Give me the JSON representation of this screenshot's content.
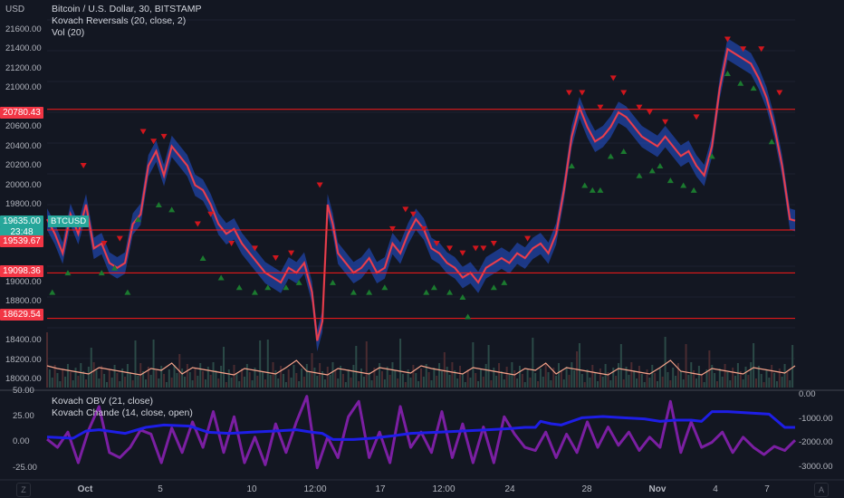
{
  "currency_label": "USD",
  "legend": {
    "title": "Bitcoin / U.S. Dollar, 30, BITSTAMP",
    "indicator1": "Kovach Reversals (20, close, 2)",
    "indicator2": "Vol (20)"
  },
  "price_axis": [
    "21600.00",
    "21400.00",
    "21200.00",
    "21000.00",
    "20600.00",
    "20400.00",
    "20200.00",
    "20000.00",
    "19800.00",
    "19000.00",
    "18800.00",
    "18400.00",
    "18200.00",
    "18000.00"
  ],
  "tags": {
    "h1": "20780.43",
    "price": "19635.00",
    "symbol": "BTCUSD",
    "countdown": "23:48",
    "h2": "19539.67",
    "h3": "19098.36",
    "h4": "18629.54"
  },
  "lower_legend": {
    "indicator1": "Kovach OBV (21, close)",
    "indicator2": "Kovach Chande (14, close, open)"
  },
  "lower_left_axis": [
    "50.00",
    "25.00",
    "0.00",
    "-25.00"
  ],
  "lower_right_axis": [
    "0.00",
    "-1000.00",
    "-2000.00",
    "-3000.00"
  ],
  "time_axis": [
    "Oct",
    "5",
    "10",
    "12:00",
    "17",
    "12:00",
    "24",
    "28",
    "Nov",
    "4",
    "7"
  ],
  "corner_left": "Z",
  "corner_right": "A",
  "colors": {
    "background": "#131722",
    "hline": "#ff1a1a",
    "price_tag": "#26a69a",
    "band": "#2962ff",
    "ma": "#f23645",
    "obv": "#1e1ee6",
    "chande": "#7b1fa2",
    "up_marker": "#1b7a2f",
    "down_marker": "#d0161d"
  },
  "chart_data": {
    "type": "line",
    "symbol": "Bitcoin / U.S. Dollar, 30, BITSTAMP",
    "price_path": [
      [
        0,
        19650
      ],
      [
        3,
        19500
      ],
      [
        6,
        19300
      ],
      [
        9,
        19700
      ],
      [
        12,
        19500
      ],
      [
        15,
        19800
      ],
      [
        18,
        19350
      ],
      [
        21,
        19400
      ],
      [
        24,
        19200
      ],
      [
        27,
        19150
      ],
      [
        30,
        19200
      ],
      [
        33,
        19600
      ],
      [
        36,
        19700
      ],
      [
        39,
        20200
      ],
      [
        42,
        20350
      ],
      [
        45,
        20100
      ],
      [
        48,
        20400
      ],
      [
        51,
        20300
      ],
      [
        54,
        20200
      ],
      [
        57,
        20000
      ],
      [
        60,
        19950
      ],
      [
        63,
        19800
      ],
      [
        66,
        19600
      ],
      [
        69,
        19500
      ],
      [
        72,
        19550
      ],
      [
        75,
        19400
      ],
      [
        78,
        19300
      ],
      [
        81,
        19200
      ],
      [
        84,
        19100
      ],
      [
        87,
        19050
      ],
      [
        90,
        19000
      ],
      [
        93,
        19150
      ],
      [
        96,
        19100
      ],
      [
        99,
        19200
      ],
      [
        102,
        18900
      ],
      [
        104,
        18400
      ],
      [
        106,
        18600
      ],
      [
        108,
        19800
      ],
      [
        110,
        19600
      ],
      [
        112,
        19300
      ],
      [
        115,
        19200
      ],
      [
        118,
        19100
      ],
      [
        121,
        19150
      ],
      [
        124,
        19250
      ],
      [
        127,
        19100
      ],
      [
        130,
        19150
      ],
      [
        133,
        19400
      ],
      [
        136,
        19300
      ],
      [
        139,
        19500
      ],
      [
        142,
        19650
      ],
      [
        145,
        19550
      ],
      [
        148,
        19350
      ],
      [
        151,
        19300
      ],
      [
        154,
        19200
      ],
      [
        157,
        19150
      ],
      [
        160,
        19050
      ],
      [
        163,
        19100
      ],
      [
        166,
        19000
      ],
      [
        169,
        19150
      ],
      [
        172,
        19200
      ],
      [
        175,
        19250
      ],
      [
        178,
        19200
      ],
      [
        181,
        19300
      ],
      [
        184,
        19250
      ],
      [
        187,
        19350
      ],
      [
        190,
        19400
      ],
      [
        193,
        19300
      ],
      [
        196,
        19500
      ],
      [
        199,
        19950
      ],
      [
        202,
        20500
      ],
      [
        205,
        20800
      ],
      [
        208,
        20600
      ],
      [
        211,
        20450
      ],
      [
        214,
        20500
      ],
      [
        217,
        20600
      ],
      [
        220,
        20750
      ],
      [
        223,
        20700
      ],
      [
        226,
        20600
      ],
      [
        229,
        20500
      ],
      [
        232,
        20450
      ],
      [
        235,
        20400
      ],
      [
        238,
        20500
      ],
      [
        241,
        20400
      ],
      [
        244,
        20300
      ],
      [
        247,
        20350
      ],
      [
        250,
        20200
      ],
      [
        253,
        20100
      ],
      [
        256,
        20400
      ],
      [
        259,
        21000
      ],
      [
        262,
        21400
      ],
      [
        265,
        21350
      ],
      [
        268,
        21300
      ],
      [
        271,
        21250
      ],
      [
        274,
        21100
      ],
      [
        277,
        20900
      ],
      [
        280,
        20600
      ],
      [
        283,
        20200
      ],
      [
        286,
        19650
      ],
      [
        288,
        19635
      ]
    ],
    "horizontal_levels": [
      20780.43,
      19539.67,
      19098.36,
      18629.54
    ],
    "last_price": 19635.0,
    "down_markers": [
      [
        14,
        20200
      ],
      [
        22,
        19400
      ],
      [
        28,
        19450
      ],
      [
        37,
        20550
      ],
      [
        41,
        20450
      ],
      [
        45,
        20500
      ],
      [
        58,
        19600
      ],
      [
        63,
        19700
      ],
      [
        71,
        19400
      ],
      [
        80,
        19350
      ],
      [
        88,
        19250
      ],
      [
        94,
        19300
      ],
      [
        105,
        20000
      ],
      [
        133,
        19550
      ],
      [
        138,
        19750
      ],
      [
        141,
        19700
      ],
      [
        145,
        19550
      ],
      [
        150,
        19400
      ],
      [
        155,
        19350
      ],
      [
        160,
        19300
      ],
      [
        165,
        19350
      ],
      [
        168,
        19350
      ],
      [
        172,
        19400
      ],
      [
        185,
        19450
      ],
      [
        201,
        20950
      ],
      [
        206,
        20950
      ],
      [
        213,
        20800
      ],
      [
        218,
        21100
      ],
      [
        222,
        20950
      ],
      [
        228,
        20800
      ],
      [
        232,
        20750
      ],
      [
        238,
        20650
      ],
      [
        250,
        20700
      ],
      [
        262,
        21500
      ],
      [
        268,
        21400
      ],
      [
        275,
        21400
      ],
      [
        282,
        20950
      ]
    ],
    "up_markers": [
      [
        2,
        18900
      ],
      [
        8,
        19100
      ],
      [
        21,
        19100
      ],
      [
        26,
        19150
      ],
      [
        31,
        18900
      ],
      [
        35,
        19650
      ],
      [
        43,
        19800
      ],
      [
        48,
        19750
      ],
      [
        60,
        19250
      ],
      [
        67,
        19050
      ],
      [
        74,
        18950
      ],
      [
        80,
        18900
      ],
      [
        85,
        18950
      ],
      [
        92,
        18950
      ],
      [
        97,
        19000
      ],
      [
        110,
        19000
      ],
      [
        118,
        18900
      ],
      [
        124,
        18900
      ],
      [
        130,
        18950
      ],
      [
        146,
        18900
      ],
      [
        149,
        18950
      ],
      [
        155,
        18900
      ],
      [
        160,
        18850
      ],
      [
        162,
        18650
      ],
      [
        172,
        18950
      ],
      [
        176,
        19000
      ],
      [
        202,
        20200
      ],
      [
        207,
        20000
      ],
      [
        210,
        19950
      ],
      [
        213,
        19950
      ],
      [
        217,
        20300
      ],
      [
        222,
        20350
      ],
      [
        228,
        20100
      ],
      [
        233,
        20150
      ],
      [
        236,
        20200
      ],
      [
        240,
        20050
      ],
      [
        245,
        20000
      ],
      [
        249,
        19950
      ],
      [
        256,
        20300
      ],
      [
        262,
        21150
      ],
      [
        267,
        21050
      ],
      [
        272,
        21000
      ],
      [
        279,
        20450
      ]
    ],
    "obv_path": [
      [
        0,
        -1750
      ],
      [
        10,
        -1800
      ],
      [
        15,
        -1500
      ],
      [
        20,
        -1450
      ],
      [
        30,
        -1600
      ],
      [
        38,
        -1350
      ],
      [
        45,
        -1250
      ],
      [
        55,
        -1300
      ],
      [
        62,
        -1550
      ],
      [
        70,
        -1600
      ],
      [
        78,
        -1550
      ],
      [
        88,
        -1500
      ],
      [
        96,
        -1450
      ],
      [
        102,
        -1550
      ],
      [
        106,
        -1600
      ],
      [
        110,
        -1850
      ],
      [
        118,
        -1850
      ],
      [
        125,
        -1800
      ],
      [
        133,
        -1700
      ],
      [
        140,
        -1600
      ],
      [
        150,
        -1550
      ],
      [
        160,
        -1500
      ],
      [
        170,
        -1450
      ],
      [
        178,
        -1400
      ],
      [
        184,
        -1350
      ],
      [
        188,
        -1350
      ],
      [
        190,
        -1100
      ],
      [
        194,
        -1200
      ],
      [
        198,
        -1250
      ],
      [
        206,
        -950
      ],
      [
        214,
        -900
      ],
      [
        222,
        -950
      ],
      [
        230,
        -1000
      ],
      [
        236,
        -1100
      ],
      [
        242,
        -1050
      ],
      [
        248,
        -1050
      ],
      [
        252,
        -1100
      ],
      [
        256,
        -700
      ],
      [
        262,
        -700
      ],
      [
        270,
        -750
      ],
      [
        278,
        -800
      ],
      [
        284,
        -1350
      ],
      [
        288,
        -1350
      ]
    ],
    "chande_path": [
      [
        0,
        3
      ],
      [
        4,
        -5
      ],
      [
        8,
        10
      ],
      [
        12,
        -20
      ],
      [
        16,
        12
      ],
      [
        20,
        35
      ],
      [
        24,
        -10
      ],
      [
        28,
        -15
      ],
      [
        32,
        -5
      ],
      [
        36,
        12
      ],
      [
        40,
        8
      ],
      [
        44,
        -20
      ],
      [
        48,
        14
      ],
      [
        52,
        -10
      ],
      [
        56,
        20
      ],
      [
        60,
        -5
      ],
      [
        64,
        30
      ],
      [
        68,
        -10
      ],
      [
        72,
        25
      ],
      [
        76,
        -20
      ],
      [
        80,
        5
      ],
      [
        84,
        -22
      ],
      [
        88,
        18
      ],
      [
        92,
        -10
      ],
      [
        96,
        20
      ],
      [
        100,
        45
      ],
      [
        104,
        -25
      ],
      [
        108,
        5
      ],
      [
        112,
        -15
      ],
      [
        116,
        25
      ],
      [
        120,
        40
      ],
      [
        124,
        -15
      ],
      [
        128,
        10
      ],
      [
        132,
        -20
      ],
      [
        136,
        35
      ],
      [
        140,
        -5
      ],
      [
        144,
        10
      ],
      [
        148,
        -10
      ],
      [
        152,
        30
      ],
      [
        156,
        -15
      ],
      [
        160,
        18
      ],
      [
        164,
        -20
      ],
      [
        168,
        15
      ],
      [
        172,
        -20
      ],
      [
        176,
        25
      ],
      [
        180,
        8
      ],
      [
        184,
        -5
      ],
      [
        188,
        -8
      ],
      [
        192,
        10
      ],
      [
        196,
        -15
      ],
      [
        200,
        8
      ],
      [
        204,
        -10
      ],
      [
        208,
        20
      ],
      [
        212,
        -5
      ],
      [
        216,
        15
      ],
      [
        220,
        -3
      ],
      [
        224,
        10
      ],
      [
        228,
        -8
      ],
      [
        232,
        5
      ],
      [
        236,
        -5
      ],
      [
        240,
        40
      ],
      [
        244,
        -10
      ],
      [
        248,
        20
      ],
      [
        252,
        -5
      ],
      [
        256,
        0
      ],
      [
        260,
        10
      ],
      [
        264,
        -10
      ],
      [
        268,
        5
      ],
      [
        272,
        -5
      ],
      [
        276,
        -12
      ],
      [
        280,
        -4
      ],
      [
        284,
        -8
      ],
      [
        288,
        2
      ]
    ],
    "price_ylim": [
      17900,
      21700
    ],
    "lower_left_ylim": [
      -35,
      50
    ],
    "lower_right_ylim": [
      -3300,
      0
    ],
    "legend_entries": [
      "Kovach Reversals (20, close, 2)",
      "Vol (20)",
      "Kovach OBV (21, close)",
      "Kovach Chande (14, close, open)"
    ]
  }
}
